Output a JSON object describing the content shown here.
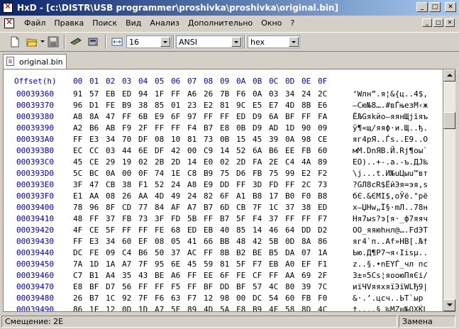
{
  "window": {
    "title": "HxD - [c:\\DISTR\\USB programmer\\proshivka\\proshivka\\original.bin]",
    "minimize": "_",
    "maximize": "□",
    "close": "✕"
  },
  "menu": [
    "Файл",
    "Правка",
    "Поиск",
    "Вид",
    "Анализ",
    "Дополнительно",
    "Окно",
    "?"
  ],
  "toolbar": {
    "icons": [
      "new-file-icon",
      "open-folder-icon",
      "save-icon",
      "ram-icon",
      "disk-icon",
      "bytes-per-row-icon"
    ],
    "bytes_per_row": "16",
    "charset": "ANSI",
    "display_mode": "hex"
  },
  "tab": {
    "label": "original.bin"
  },
  "editor": {
    "offset_header": "Offset(h)",
    "column_headers": [
      "00",
      "01",
      "02",
      "03",
      "04",
      "05",
      "06",
      "07",
      "08",
      "09",
      "0A",
      "0B",
      "0C",
      "0D",
      "0E",
      "0F"
    ],
    "rows": [
      {
        "offset": "00039360",
        "bytes": [
          "91",
          "57",
          "EB",
          "ED",
          "94",
          "1F",
          "FF",
          "A6",
          "26",
          "7B",
          "F6",
          "0A",
          "03",
          "34",
          "24",
          "2C"
        ],
        "text": "‘Wлн”.я¦&{ц..4$,"
      },
      {
        "offset": "00039370",
        "bytes": [
          "96",
          "D1",
          "FE",
          "B9",
          "38",
          "85",
          "01",
          "23",
          "E2",
          "81",
          "9C",
          "E5",
          "E7",
          "4D",
          "8B",
          "E6"
        ],
        "text": "–Сю№8….#вЃњезМ‹ж"
      },
      {
        "offset": "00039380",
        "bytes": [
          "A8",
          "8A",
          "47",
          "FF",
          "6B",
          "E9",
          "6F",
          "97",
          "FF",
          "FF",
          "ED",
          "D9",
          "6A",
          "BF",
          "FF",
          "FA"
        ],
        "text": "ЁЉGяkйo—яянЩjїяъ"
      },
      {
        "offset": "00039390",
        "bytes": [
          "A2",
          "B6",
          "AB",
          "F9",
          "2F",
          "FF",
          "FF",
          "F4",
          "B7",
          "E8",
          "0B",
          "D9",
          "AD",
          "1D",
          "90",
          "09"
        ],
        "text": "ў¶«щ/яяф·и.Щ..ђ."
      },
      {
        "offset": "000393A0",
        "bytes": [
          "FF",
          "E3",
          "34",
          "70",
          "DF",
          "08",
          "10",
          "81",
          "73",
          "0B",
          "15",
          "45",
          "39",
          "0A",
          "98",
          "CE"
        ],
        "text": "яг4pЯ..Ѓs..E9..О"
      },
      {
        "offset": "000393B0",
        "bytes": [
          "EC",
          "CC",
          "03",
          "44",
          "6E",
          "DF",
          "42",
          "00",
          "C9",
          "14",
          "52",
          "6A",
          "B6",
          "EE",
          "FB",
          "60"
        ],
        "text": "мМ.DnЯB.Й.Rj¶оы`"
      },
      {
        "offset": "000393C0",
        "bytes": [
          "45",
          "CE",
          "29",
          "19",
          "02",
          "2B",
          "2D",
          "14",
          "E0",
          "02",
          "2D",
          "FA",
          "2E",
          "C4",
          "4A",
          "89"
        ],
        "text": "EО)..+-.а.-ъ.ДJ‰"
      },
      {
        "offset": "000393D0",
        "bytes": [
          "5C",
          "BC",
          "0A",
          "00",
          "0F",
          "74",
          "1E",
          "C8",
          "B9",
          "75",
          "D6",
          "FB",
          "75",
          "99",
          "E2",
          "F2"
        ],
        "text": "\\ј...t.И№uЦыu™вт"
      },
      {
        "offset": "000393E0",
        "bytes": [
          "3F",
          "47",
          "CB",
          "38",
          "F1",
          "52",
          "24",
          "A8",
          "E9",
          "DD",
          "FF",
          "3D",
          "FD",
          "FF",
          "2C",
          "73"
        ],
        "text": "?GЛ8сR$ЁйЭя=эя,s"
      },
      {
        "offset": "000393F0",
        "bytes": [
          "E1",
          "AA",
          "08",
          "26",
          "AA",
          "4D",
          "49",
          "24",
          "82",
          "6F",
          "A1",
          "B8",
          "17",
          "B0",
          "F0",
          "B8"
        ],
        "text": "бЄ.&ЄMI$‚oЎё.°рё"
      },
      {
        "offset": "00039400",
        "bytes": [
          "78",
          "96",
          "8F",
          "CD",
          "77",
          "84",
          "AF",
          "A7",
          "B7",
          "6D",
          "CB",
          "7F",
          "1C",
          "37",
          "38",
          "ED"
        ],
        "text": "x–ЏНw„Ї§·mЛ..78н"
      },
      {
        "offset": "00039410",
        "bytes": [
          "48",
          "FF",
          "37",
          "FB",
          "73",
          "3F",
          "FD",
          "5B",
          "FF",
          "B7",
          "5F",
          "F4",
          "37",
          "FF",
          "FF",
          "F7"
        ],
        "text": "Hя7ыs?э[я·_ф7яяч"
      },
      {
        "offset": "00039420",
        "bytes": [
          "4F",
          "CE",
          "5F",
          "FF",
          "FF",
          "FE",
          "68",
          "ED",
          "EB",
          "40",
          "85",
          "14",
          "46",
          "64",
          "DD",
          "D2"
        ],
        "text": "OО_яяюhнл@….FdЭТ"
      },
      {
        "offset": "00039430",
        "bytes": [
          "FF",
          "E3",
          "34",
          "60",
          "EF",
          "08",
          "05",
          "41",
          "66",
          "BB",
          "48",
          "42",
          "5B",
          "0D",
          "8A",
          "86"
        ],
        "text": "яг4`п..Af»HB[.Љ†"
      },
      {
        "offset": "00039440",
        "bytes": [
          "DC",
          "FE",
          "09",
          "C4",
          "B6",
          "50",
          "37",
          "AC",
          "FF",
          "8B",
          "B2",
          "BE",
          "B5",
          "DA",
          "07",
          "1A"
        ],
        "text": "Ью.Д¶P7¬я‹Ііѕµ.."
      },
      {
        "offset": "00039450",
        "bytes": [
          "7A",
          "1D",
          "1A",
          "A7",
          "7F",
          "95",
          "6E",
          "45",
          "59",
          "81",
          "5F",
          "F7",
          "EB",
          "A0",
          "EF",
          "F1"
        ],
        "text": "z..§.•nEYЃ_чл пс"
      },
      {
        "offset": "00039460",
        "bytes": [
          "C7",
          "B1",
          "A4",
          "35",
          "43",
          "BE",
          "A6",
          "FF",
          "EE",
          "6F",
          "FE",
          "CF",
          "FF",
          "AA",
          "69",
          "2F"
        ],
        "text": "З±¤5Cѕ¦яоoюПяЄi/"
      },
      {
        "offset": "00039470",
        "bytes": [
          "E8",
          "BF",
          "D7",
          "56",
          "FF",
          "FF",
          "F5",
          "FF",
          "BF",
          "DD",
          "BF",
          "57",
          "4C",
          "80",
          "39",
          "7C"
        ],
        "text": "иїЧVяяхяїЭїWLЂ9|"
      },
      {
        "offset": "00039480",
        "bytes": [
          "26",
          "B7",
          "1C",
          "92",
          "7F",
          "F6",
          "63",
          "F7",
          "12",
          "98",
          "00",
          "DC",
          "54",
          "60",
          "FB",
          "F0"
        ],
        "text": "&·.’.цcч..ЬT`ыр"
      },
      {
        "offset": "00039490",
        "bytes": [
          "86",
          "1F",
          "12",
          "0D",
          "1D",
          "A7",
          "5F",
          "89",
          "4D",
          "5A",
          "F8",
          "B9",
          "4F",
          "58",
          "8D",
          "4C"
        ],
        "text": "†....§_‰MZш№OXЌL"
      }
    ]
  },
  "status": {
    "offset": "Смещение: 2E",
    "mode": "Замена"
  }
}
